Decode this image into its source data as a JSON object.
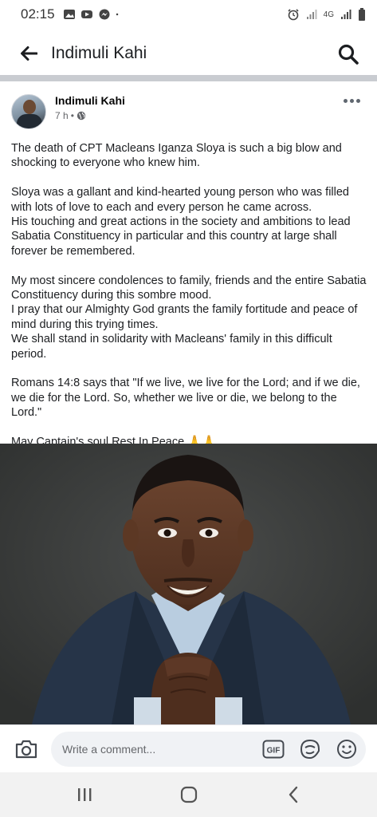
{
  "status_bar": {
    "time": "02:15",
    "network_label": "4G"
  },
  "header": {
    "title": "Indimuli Kahi"
  },
  "post": {
    "author": "Indimuli Kahi",
    "time_ago": "7 h",
    "separator": "•",
    "paragraphs": [
      "The death of CPT Macleans Iganza Sloya is such a big blow and shocking to everyone who knew him.",
      "Sloya was a gallant and kind-hearted young person who was filled with lots of love to each and every person he came across.",
      "His touching and great actions in the society and ambitions to lead Sabatia Constituency in particular and this country at large shall forever be remembered.",
      "My most sincere condolences to family, friends and the entire Sabatia Constituency during this sombre mood.",
      "I pray that our Almighty God grants the family fortitude and peace of mind during this trying times.",
      "We shall stand in solidarity with Macleans' family in this difficult period.",
      "Romans 14:8 says that \"If we live, we live for the Lord; and if we die, we die for the Lord. So, whether we live or die, we belong to the Lord.\"",
      "May Captain's soul Rest In Peace.🙏🙏"
    ]
  },
  "comment_bar": {
    "placeholder": "Write a comment...",
    "gif_label": "GIF"
  },
  "icons": {
    "back": "arrow-left-icon",
    "search": "search-icon",
    "more": "more-horizontal-icon",
    "camera": "camera-icon",
    "gif": "gif-icon",
    "sticker": "sticker-icon",
    "emoji": "emoji-icon",
    "globe": "globe-icon"
  }
}
